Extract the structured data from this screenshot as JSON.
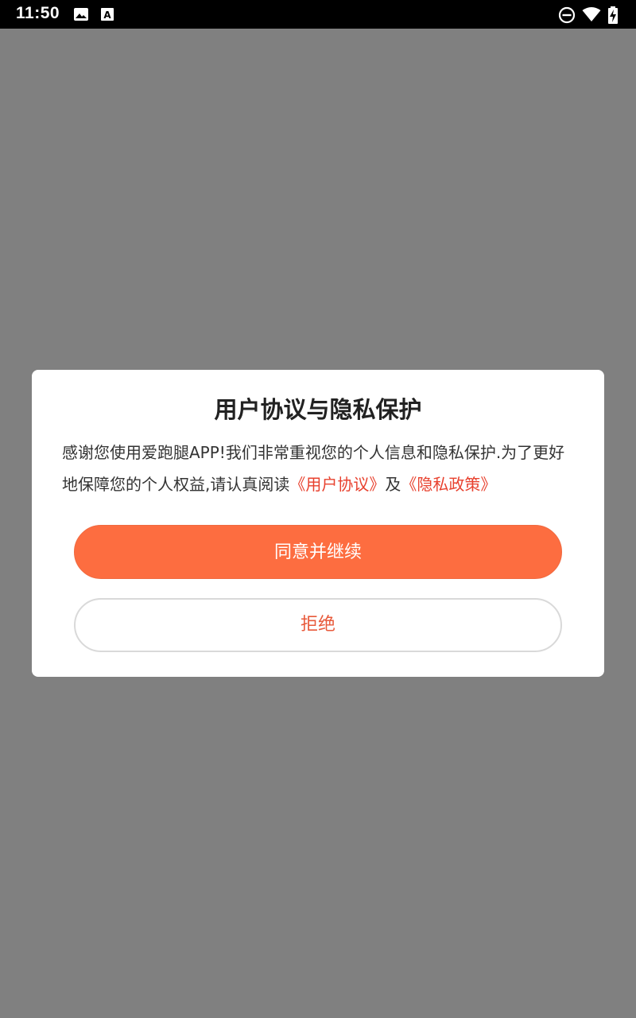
{
  "status_bar": {
    "time": "11:50",
    "icons": [
      "image-icon",
      "font-download-icon",
      "do-not-disturb-icon",
      "wifi-icon",
      "battery-charging-icon"
    ]
  },
  "dialog": {
    "title": "用户协议与隐私保护",
    "message_prefix": "感谢您使用爱跑腿APP!我们非常重视您的个人信息和隐私保护.为了更好地保障您的个人权益,请认真阅读",
    "user_agreement_link": "《用户协议》",
    "conjunction": "及",
    "privacy_policy_link": "《隐私政策》",
    "agree_button": "同意并继续",
    "reject_button": "拒绝"
  },
  "colors": {
    "accent": "#fd6d40",
    "link": "#e8412e",
    "overlay": "#808080"
  }
}
